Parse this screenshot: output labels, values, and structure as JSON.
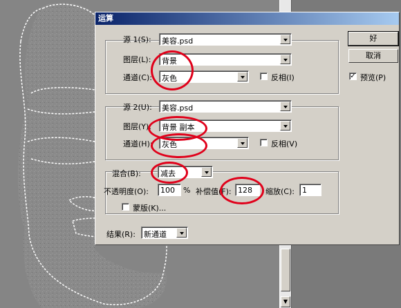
{
  "dialog": {
    "title": "运算"
  },
  "source1": {
    "label": "源 1(S):",
    "source_value": "美容.psd",
    "layer_label": "图层(L):",
    "layer_value": "背景",
    "channel_label": "通道(C):",
    "channel_value": "灰色",
    "invert_label": "反相(I)",
    "invert_checked": false
  },
  "source2": {
    "label": "源 2(U):",
    "source_value": "美容.psd",
    "layer_label": "图层(Y):",
    "layer_value": "背景 副本",
    "channel_label": "通道(H):",
    "channel_value": "灰色",
    "invert_label": "反相(V)",
    "invert_checked": false
  },
  "blending": {
    "label": "混合(B):",
    "mode_value": "减去",
    "opacity_label": "不透明度(O):",
    "opacity_value": "100",
    "opacity_unit": "%",
    "offset_label": "补偿值(F):",
    "offset_value": "128",
    "scale_label": "缩放(C):",
    "scale_value": "1",
    "mask_label": "蒙版(K)...",
    "mask_checked": false
  },
  "result": {
    "label": "结果(R):",
    "value": "新通道"
  },
  "buttons": {
    "ok": "好",
    "cancel": "取消"
  },
  "preview": {
    "label": "预览(P)",
    "checked": true
  },
  "colors": {
    "highlight_circle": "#e0001a",
    "titlebar_start": "#0a246a",
    "titlebar_end": "#a6caf0",
    "dialog_face": "#d4d0c8"
  }
}
